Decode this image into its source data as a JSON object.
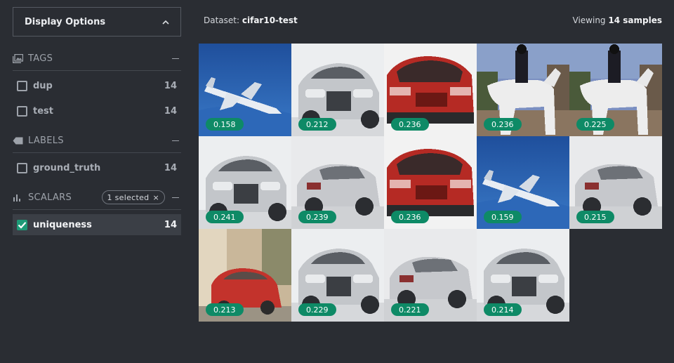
{
  "sidebar": {
    "display_options_label": "Display Options",
    "tags": {
      "title": "TAGS",
      "items": [
        {
          "label": "dup",
          "count": "14"
        },
        {
          "label": "test",
          "count": "14"
        }
      ]
    },
    "labels": {
      "title": "LABELS",
      "items": [
        {
          "label": "ground_truth",
          "count": "14"
        }
      ]
    },
    "scalars": {
      "title": "SCALARS",
      "selected_pill": "1 selected",
      "items": [
        {
          "label": "uniqueness",
          "count": "14",
          "checked": true
        }
      ]
    }
  },
  "header": {
    "dataset_prefix": "Dataset:",
    "dataset_name": "cifar10-test",
    "viewing_prefix": "Viewing",
    "viewing_count": "14 samples"
  },
  "colors": {
    "background": "#2a2d33",
    "accent": "#1d9a77",
    "badge": "#0e8a66"
  },
  "samples": [
    {
      "subject": "airplane",
      "uniqueness": "0.158"
    },
    {
      "subject": "silver-car",
      "uniqueness": "0.212"
    },
    {
      "subject": "red-car",
      "uniqueness": "0.236"
    },
    {
      "subject": "horse-rider",
      "uniqueness": "0.236"
    },
    {
      "subject": "horse-rider",
      "uniqueness": "0.225"
    },
    {
      "subject": "silver-car",
      "uniqueness": "0.241"
    },
    {
      "subject": "silver-car-rear",
      "uniqueness": "0.239"
    },
    {
      "subject": "red-car",
      "uniqueness": "0.236"
    },
    {
      "subject": "airplane",
      "uniqueness": "0.159"
    },
    {
      "subject": "silver-car-rear",
      "uniqueness": "0.215"
    },
    {
      "subject": "red-car-street",
      "uniqueness": "0.213"
    },
    {
      "subject": "silver-car",
      "uniqueness": "0.229"
    },
    {
      "subject": "silver-car-rear",
      "uniqueness": "0.221"
    },
    {
      "subject": "silver-car",
      "uniqueness": "0.214"
    }
  ]
}
